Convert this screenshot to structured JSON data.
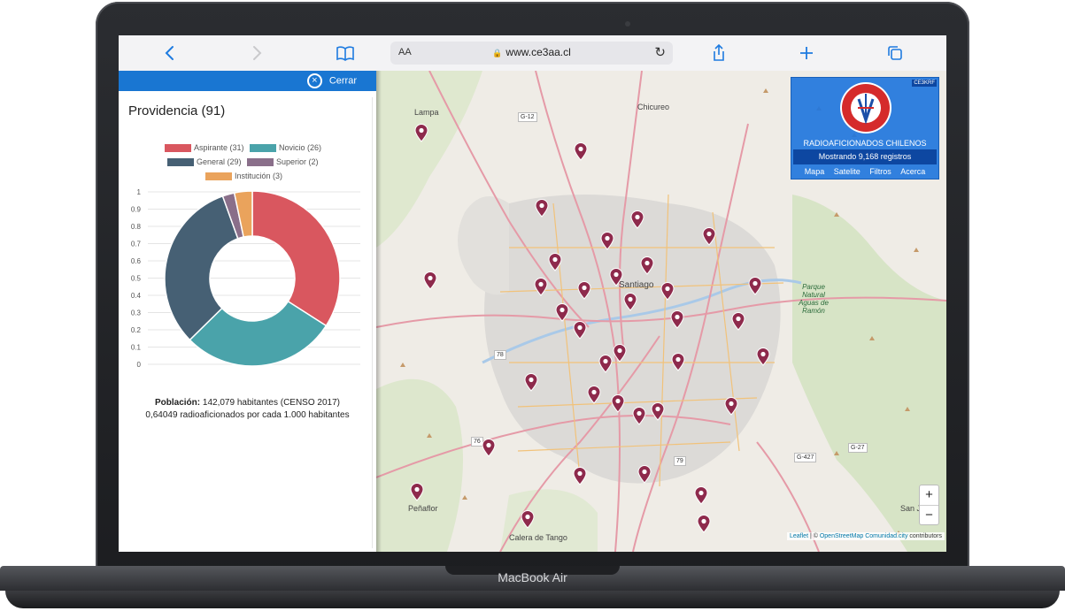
{
  "device": {
    "brand": "MacBook Air"
  },
  "browser": {
    "aa_label": "AA",
    "url": "www.ce3aa.cl",
    "icons": [
      "back-icon",
      "forward-icon",
      "bookmarks-icon",
      "reload-icon",
      "share-icon",
      "new-tab-icon",
      "tabs-icon"
    ]
  },
  "panel": {
    "close_label": "Cerrar",
    "title": "Providencia (91)",
    "population_label": "Población:",
    "population_value": "142,079 habitantes (CENSO 2017)",
    "ratio_text": "0,64049 radioaficionados por cada 1.000 habitantes"
  },
  "chart_data": {
    "type": "pie",
    "donut": true,
    "categories": [
      "Aspirante (31)",
      "Novicio (26)",
      "General (29)",
      "Superior (2)",
      "Institución (3)"
    ],
    "values": [
      31,
      26,
      29,
      2,
      3
    ],
    "colors": [
      "#d9575f",
      "#4aa3aa",
      "#466074",
      "#8a6f8a",
      "#eaa35c"
    ],
    "y_ticks": [
      "1",
      "0.9",
      "0.8",
      "0.7",
      "0.6",
      "0.5",
      "0.4",
      "0.3",
      "0.2",
      "0.1",
      "0"
    ],
    "grid": true,
    "legend_position": "top"
  },
  "map": {
    "labels": [
      "Lampa",
      "Chicureo",
      "Santiago",
      "Peñaflor",
      "Calera de Tango",
      "Parque Natural Aguas de Ramón",
      "San J"
    ],
    "road_shields": [
      "G-12",
      "G-427",
      "G-27",
      "78",
      "76",
      "79"
    ],
    "info": {
      "callsign": "CE3KRF",
      "logo_text": "RADIO CLUB DE CHILE 1922",
      "title": "RADIOAFICIONADOS CHILENOS",
      "count": "Mostrando 9,168 registros",
      "menu": [
        "Mapa",
        "Satelite",
        "Filtros",
        "Acerca"
      ]
    },
    "zoom_in": "+",
    "zoom_out": "−",
    "attribution": {
      "leaflet": "Leaflet",
      "sep": " | © ",
      "osm": "OpenStreetMap",
      "comunidad": "Comunidad.city",
      "contributors": " contributors"
    },
    "marker_color": "#8e2a4c"
  }
}
